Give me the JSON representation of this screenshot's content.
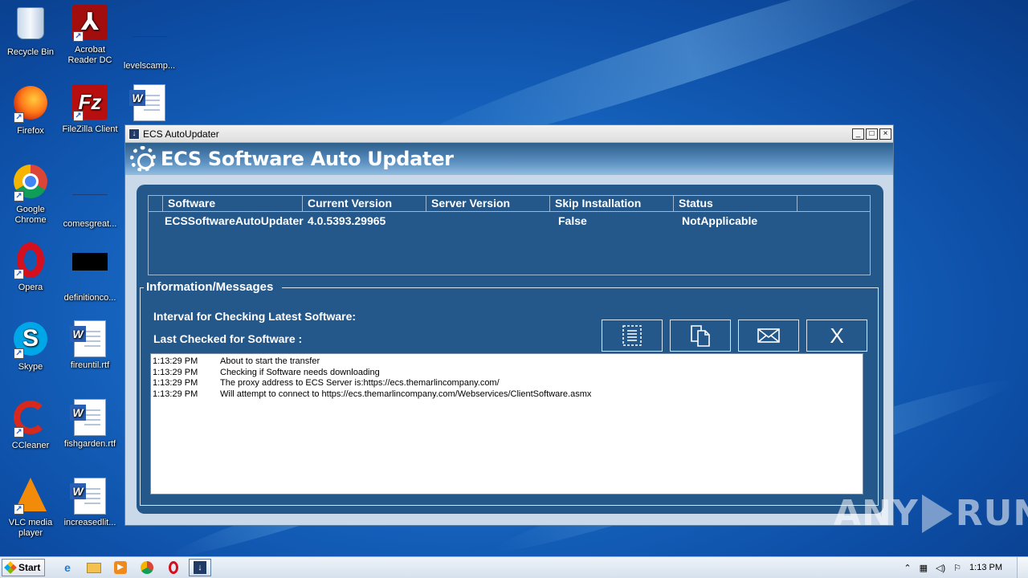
{
  "desktop": {
    "icons": [
      {
        "label": "Recycle Bin"
      },
      {
        "label": "Acrobat Reader DC"
      },
      {
        "label": "levelscamp..."
      },
      {
        "label": "Firefox"
      },
      {
        "label": "FileZilla Client"
      },
      {
        "label": ""
      },
      {
        "label": "Google Chrome"
      },
      {
        "label": "comesgreat..."
      },
      {
        "label": "Opera"
      },
      {
        "label": "definitionco..."
      },
      {
        "label": "Skype"
      },
      {
        "label": "fireuntil.rtf"
      },
      {
        "label": "CCleaner"
      },
      {
        "label": "fishgarden.rtf"
      },
      {
        "label": "VLC media player"
      },
      {
        "label": "increasedlit..."
      }
    ]
  },
  "window": {
    "title": "ECS AutoUpdater",
    "header_title": "ECS Software Auto Updater",
    "controls": {
      "minimize": "_",
      "maximize": "□",
      "close": "×"
    }
  },
  "grid": {
    "columns": [
      "Software",
      "Current Version",
      "Server Version",
      "Skip Installation",
      "Status"
    ],
    "rows": [
      {
        "software": "ECSSoftwareAutoUpdater",
        "current_version": "4.0.5393.29965",
        "server_version": "",
        "skip_installation": "False",
        "status": "NotApplicable"
      }
    ]
  },
  "info": {
    "legend": "Information/Messages",
    "interval_label": "Interval for Checking Latest Software:",
    "last_checked_label": "Last Checked for Software :",
    "buttons": {
      "close_label": "X"
    },
    "log": [
      {
        "time": "1:13:29 PM",
        "message": "About to start the transfer"
      },
      {
        "time": "1:13:29 PM",
        "message": "Checking if Software needs downloading"
      },
      {
        "time": "1:13:29 PM",
        "message": "The proxy address to ECS Server is:https://ecs.themarlincompany.com/"
      },
      {
        "time": "1:13:29 PM",
        "message": "Will attempt to connect to https://ecs.themarlincompany.com/Webservices/ClientSoftware.asmx"
      }
    ]
  },
  "taskbar": {
    "start_label": "Start",
    "clock": "1:13 PM"
  },
  "watermark": {
    "left": "ANY",
    "right": "RUN"
  }
}
